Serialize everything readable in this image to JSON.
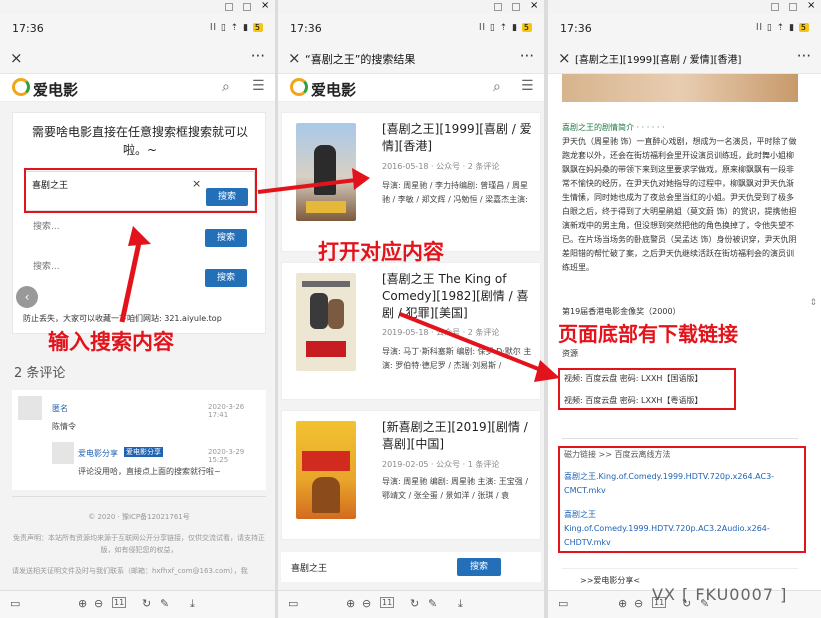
{
  "status": {
    "time": "17:36",
    "signal": "ll ▯ ⇡ ▮",
    "battery": "5"
  },
  "p1": {
    "close": "×",
    "more": "···",
    "logo": "爱电影",
    "search_title": "需要啥电影直接在任意搜索框搜索就可以啦。~",
    "input1_value": "喜剧之王",
    "clear": "×",
    "btn": "搜索",
    "input2_placeholder": "搜索...",
    "input3_placeholder": "搜索...",
    "notice": "防止丢失，大家可以收藏一下咱们网站: 321.aiyule.top",
    "comments_heading": "2 条评论",
    "comment1_user": "匿名",
    "comment1_date": "2020-3-26 17:41",
    "comment1_text": "陈情令",
    "comment2_user": "爱电影分享",
    "comment2_badge": "爱电影分享",
    "comment2_date": "2020-3-29 15:25",
    "comment2_text": "评论没用哈，直接点上面的搜索就行啦~",
    "copyright": "© 2020 · 豫ICP备12021761号",
    "disclaimer": "免责声明：本站所有资源均来源于互联网公开分享链接，仅供交流试看，请支持正版，如有侵犯您的权益，",
    "contact": "请发送相关证明文件及时与我们联系（邮箱：hxfhxf_com@163.com），我",
    "annotation": "输入搜索内容"
  },
  "p2": {
    "close": "×",
    "title": "“喜剧之王”的搜索结果",
    "more": "···",
    "logo": "爱电影",
    "cards": [
      {
        "title": "[喜剧之王][1999][喜剧 / 爱情][香港]",
        "date": "2016-05-18",
        "source": "公众号",
        "comments": "2 条评论",
        "desc": "导演: 周星驰 / 李力持编剧: 曾瑾昌 / 周星驰 / 李敏 / 郑文辉 / 冯勉恒 / 梁嘉杰主演:"
      },
      {
        "title": "[喜剧之王 The King of Comedy][1982][剧情 / 喜剧 / 犯罪][美国]",
        "date": "2019-05-18",
        "source": "公众号",
        "comments": "2 条评论",
        "desc": "导演: 马丁·斯科塞斯 编剧: 保罗·D·默尔 主演: 罗伯特·德尼罗 / 杰瑞·刘易斯 /"
      },
      {
        "title": "[新喜剧之王][2019][剧情 / 喜剧][中国]",
        "date": "2019-02-05",
        "source": "公众号",
        "comments": "1 条评论",
        "desc": "导演: 周星驰 编剧: 周星驰 主演: 王宝强 / 鄂靖文 / 张全蛋 / 景如洋 / 张琪 / 袁"
      }
    ],
    "search_value": "喜剧之王",
    "btn": "搜索",
    "annotation": "打开对应内容"
  },
  "p3": {
    "close": "×",
    "title": "[喜剧之王][1999][喜剧 / 爱情][香港]",
    "more": "···",
    "section_title": "喜剧之王的剧情简介 · · · · · ·",
    "synopsis": "尹天仇（周星驰 饰）一直醉心戏剧，想成为一名演员，平时除了做跑龙套以外，还会在街坊福利会里开设演员训练班，此时舞小姐柳飘飘在妈妈桑的带领下来到这里要求学做戏，原来柳飘飘有一段非常不愉快的经历，在尹天仇对她指导的过程中，柳飘飘对尹天仇渐生情愫，同时她也成为了夜总会里当红的小姐。尹天仇受到了极多白眼之后，终于得到了大明星鹃姐（莫文蔚 饰）的赏识，提携他担演新戏中的男主角，但没想到突然把他的角色换掉了，令他失望不已。在片场当场务的卧底警员（吴孟达 饰）身份被识穿，尹天仇阴差阳错的帮忙破了案，之后尹天仇继续活跃在街坊福利会的演员训练班里。",
    "award": "第19届香港电影金像奖（2000）",
    "resource_label": "资源",
    "res1": "视频: 百度云盘  密码: LXXH【国语版】",
    "res2": "视频: 百度云盘  密码: LXXH【粤语版】",
    "magnet_heading": "磁力链接 >> 百度云离线方法",
    "mag1": "喜剧之王.King.of.Comedy.1999.HDTV.720p.x264.AC3-CMCT.mkv",
    "mag2": "喜剧之王 King.of.Comedy.1999.HDTV.720p.AC3.2Audio.x264-CHDTV.mkv",
    "footer_tease": ">>爱电影分享<",
    "annotation": "页面底部有下载链接",
    "watermark": "VX [ FKU0007 ]"
  },
  "colors": {
    "accent": "#e3131b",
    "link": "#1f63b5",
    "button": "#2470b8"
  }
}
